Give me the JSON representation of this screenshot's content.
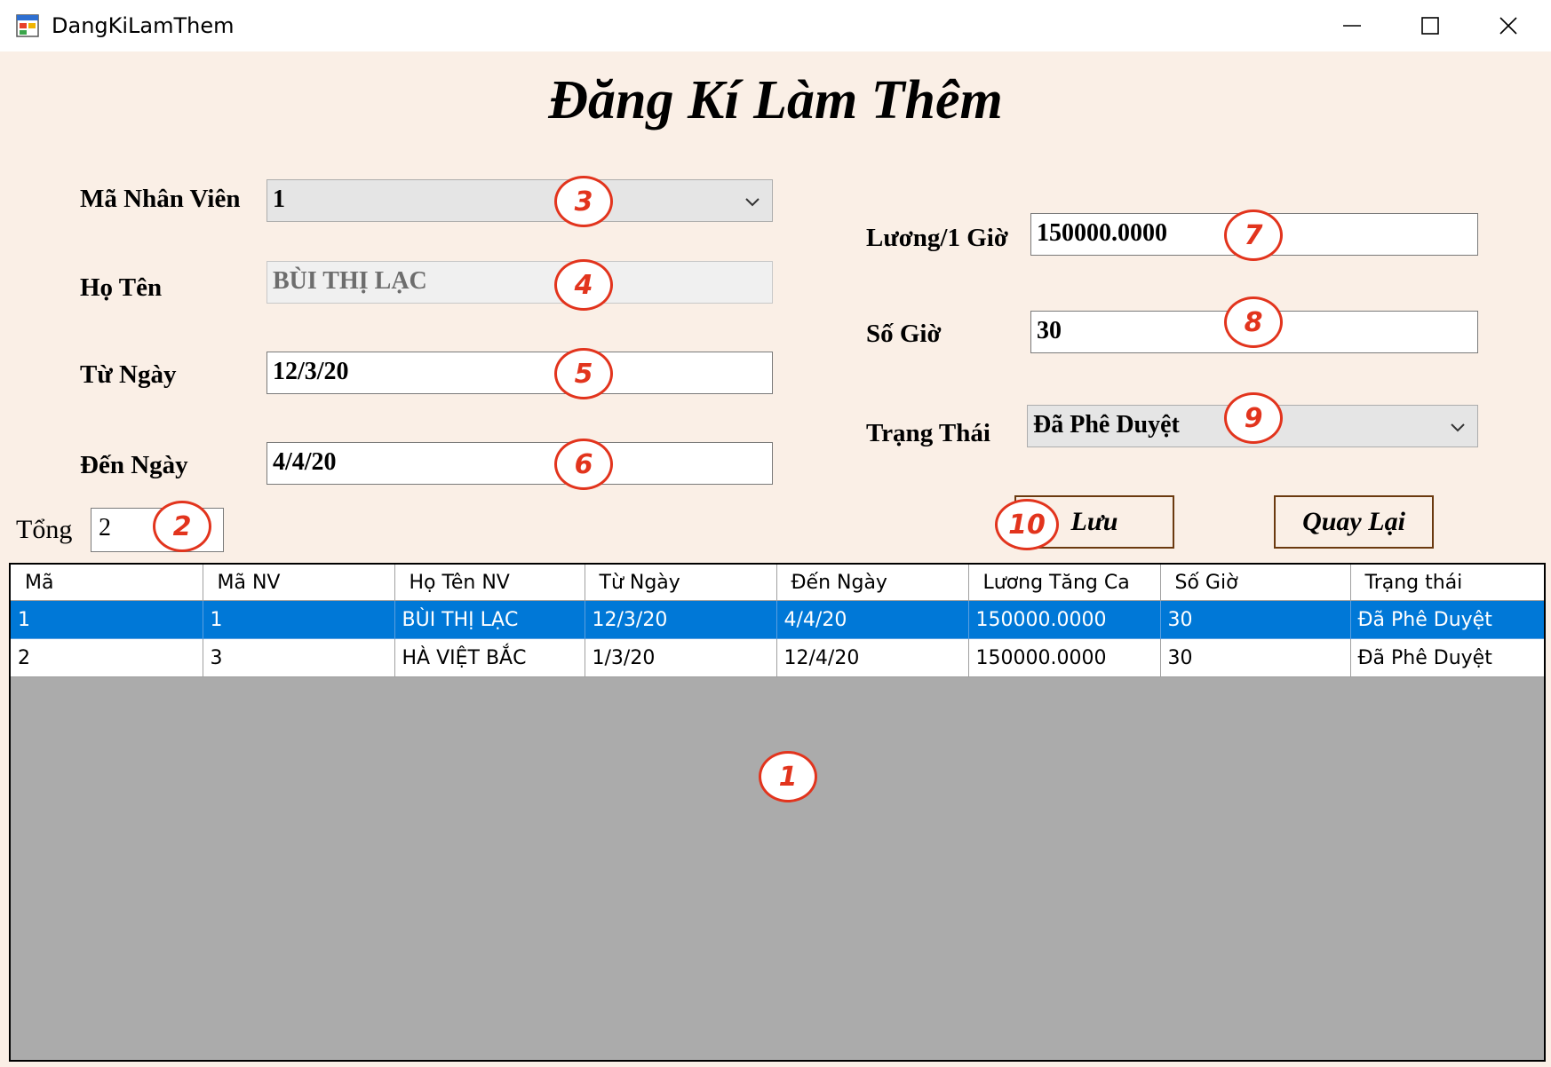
{
  "window": {
    "title": "DangKiLamThem",
    "icon": "app-window-icon"
  },
  "heading": "Đăng Kí Làm Thêm",
  "form": {
    "ma_nhan_vien": {
      "label": "Mã Nhân Viên",
      "value": "1"
    },
    "ho_ten": {
      "label": "Họ Tên",
      "value": "BÙI THỊ LẠC"
    },
    "tu_ngay": {
      "label": "Từ Ngày",
      "value": "12/3/20"
    },
    "den_ngay": {
      "label": "Đến Ngày",
      "value": "4/4/20"
    },
    "luong": {
      "label": "Lương/1 Giờ",
      "value": "150000.0000"
    },
    "so_gio": {
      "label": "Số Giờ",
      "value": "30"
    },
    "trang_thai": {
      "label": "Trạng Thái",
      "value": "Đã Phê Duyệt"
    }
  },
  "buttons": {
    "luu": "Lưu",
    "quay_lai": "Quay Lại"
  },
  "tong": {
    "label": "Tổng",
    "value": "2"
  },
  "table": {
    "columns": [
      "Mã",
      "Mã NV",
      "Họ Tên NV",
      "Từ Ngày",
      "Đến Ngày",
      "Lương Tăng Ca",
      "Số Giờ",
      "Trạng thái"
    ],
    "rows": [
      [
        "1",
        "1",
        "BÙI THỊ LẠC",
        "12/3/20",
        "4/4/20",
        "150000.0000",
        "30",
        "Đã Phê Duyệt"
      ],
      [
        "2",
        "3",
        "HÀ VIỆT BẮC",
        "1/3/20",
        "12/4/20",
        "150000.0000",
        "30",
        "Đã Phê Duyệt"
      ]
    ],
    "selected_row": 0
  },
  "markers": [
    "1",
    "2",
    "3",
    "4",
    "5",
    "6",
    "7",
    "8",
    "9",
    "10"
  ],
  "colors": {
    "background": "#faefe6",
    "selection": "#0078d7",
    "marker": "#e2341d",
    "button_border": "#6b3a10"
  }
}
